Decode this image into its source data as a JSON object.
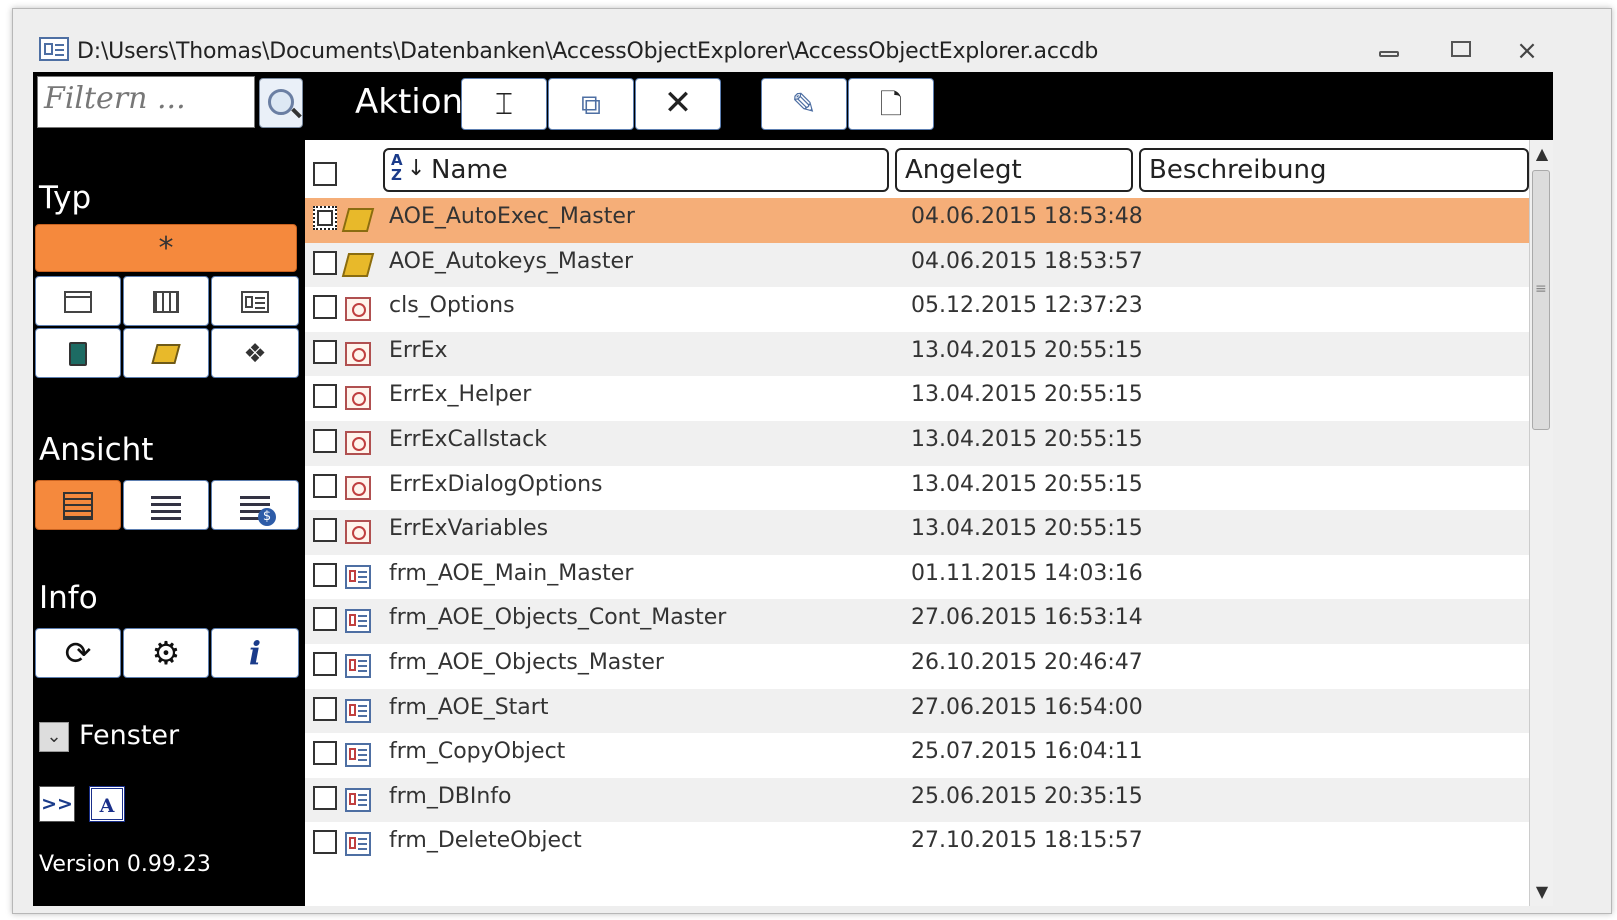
{
  "window": {
    "title": "D:\\Users\\Thomas\\Documents\\Datenbanken\\AccessObjectExplorer\\AccessObjectExplorer.accdb",
    "minimize_icon": "minimize-icon",
    "maximize_icon": "maximize-icon",
    "close_glyph": "⨯"
  },
  "filter": {
    "placeholder": "Filtern ...",
    "search_icon": "magnifier-icon"
  },
  "toolbar": {
    "label": "Aktion",
    "buttons": [
      {
        "icon": "rename-icon",
        "glyph": "⌶"
      },
      {
        "icon": "copy-icon",
        "glyph": "⧉"
      },
      {
        "icon": "delete-icon",
        "glyph": "✕"
      },
      {
        "icon": "design-icon",
        "glyph": "✎"
      },
      {
        "icon": "new-object-icon",
        "glyph": "🗋"
      }
    ]
  },
  "sidebar": {
    "typ_label": "Typ",
    "all_label": "*",
    "ansicht_label": "Ansicht",
    "info_label": "Info",
    "refresh_glyph": "⟳",
    "settings_glyph": "⚙",
    "info_glyph": "i",
    "fenster_label": "Fenster",
    "fenster_glyph": "⌄",
    "expand_label": ">>",
    "access_label": "A",
    "version": "Version 0.99.23"
  },
  "colors": {
    "accent": "#f5893d",
    "selected_row": "#f5ae78",
    "panel_bg": "#000000"
  },
  "list": {
    "columns": {
      "name": "Name",
      "angelegt": "Angelegt",
      "beschreibung": "Beschreibung",
      "sort_icon": "sort-az-icon"
    },
    "rows": [
      {
        "type": "macro",
        "name": "AOE_AutoExec_Master",
        "date": "04.06.2015 18:53:48",
        "selected": true
      },
      {
        "type": "macro",
        "name": "AOE_Autokeys_Master",
        "date": "04.06.2015 18:53:57"
      },
      {
        "type": "module",
        "name": "cls_Options",
        "date": "05.12.2015 12:37:23"
      },
      {
        "type": "module",
        "name": "ErrEx",
        "date": "13.04.2015 20:55:15"
      },
      {
        "type": "module",
        "name": "ErrEx_Helper",
        "date": "13.04.2015 20:55:15"
      },
      {
        "type": "module",
        "name": "ErrExCallstack",
        "date": "13.04.2015 20:55:15"
      },
      {
        "type": "module",
        "name": "ErrExDialogOptions",
        "date": "13.04.2015 20:55:15"
      },
      {
        "type": "module",
        "name": "ErrExVariables",
        "date": "13.04.2015 20:55:15"
      },
      {
        "type": "form",
        "name": "frm_AOE_Main_Master",
        "date": "01.11.2015 14:03:16"
      },
      {
        "type": "form",
        "name": "frm_AOE_Objects_Cont_Master",
        "date": "27.06.2015 16:53:14"
      },
      {
        "type": "form",
        "name": "frm_AOE_Objects_Master",
        "date": "26.10.2015 20:46:47"
      },
      {
        "type": "form",
        "name": "frm_AOE_Start",
        "date": "27.06.2015 16:54:00"
      },
      {
        "type": "form",
        "name": "frm_CopyObject",
        "date": "25.07.2015 16:04:11"
      },
      {
        "type": "form",
        "name": "frm_DBInfo",
        "date": "25.06.2015 20:35:15"
      },
      {
        "type": "form",
        "name": "frm_DeleteObject",
        "date": "27.10.2015 18:15:57"
      }
    ]
  }
}
